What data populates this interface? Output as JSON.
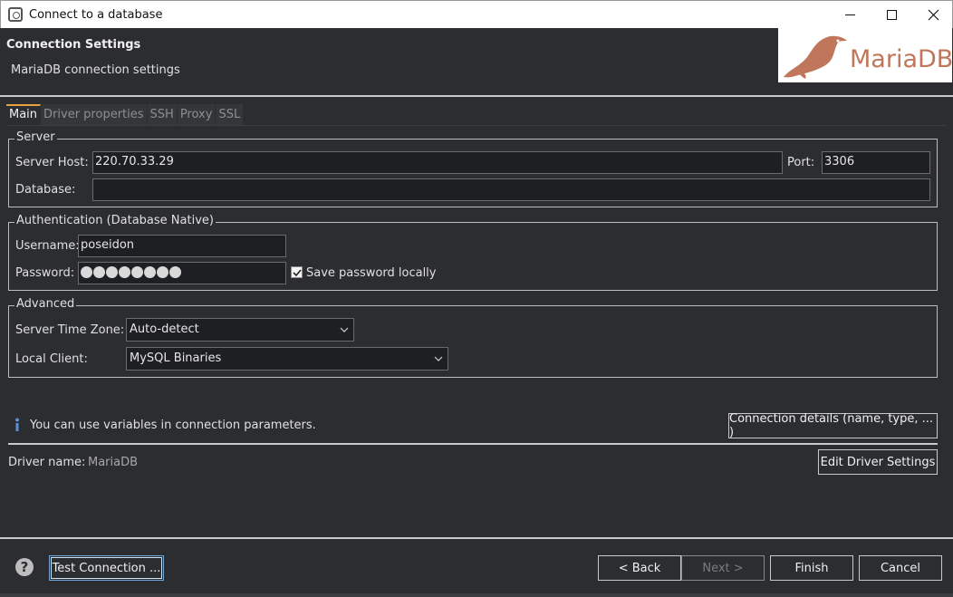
{
  "window": {
    "title": "Connect to a database"
  },
  "header": {
    "title": "Connection Settings",
    "subtitle": "MariaDB connection settings",
    "logo_text": "MariaDB"
  },
  "tabs": [
    {
      "label": "Main",
      "active": true
    },
    {
      "label": "Driver properties",
      "active": false
    },
    {
      "label": "SSH",
      "active": false
    },
    {
      "label": "Proxy",
      "active": false
    },
    {
      "label": "SSL",
      "active": false
    }
  ],
  "server": {
    "legend": "Server",
    "host_label": "Server Host:",
    "host_value": "220.70.33.29",
    "port_label": "Port:",
    "port_value": "3306",
    "database_label": "Database:",
    "database_value": ""
  },
  "auth": {
    "legend": "Authentication (Database Native)",
    "username_label": "Username:",
    "username_value": "poseidon",
    "password_label": "Password:",
    "password_length": 8,
    "save_password_label": "Save password locally",
    "save_password_checked": true
  },
  "advanced": {
    "legend": "Advanced",
    "timezone_label": "Server Time Zone:",
    "timezone_value": "Auto-detect",
    "client_label": "Local Client:",
    "client_value": "MySQL Binaries"
  },
  "info": {
    "text": "You can use variables in connection parameters.",
    "details_button": "Connection details (name, type, ... )"
  },
  "driver": {
    "label": "Driver name:",
    "value": "MariaDB",
    "edit_button": "Edit Driver Settings"
  },
  "footer": {
    "test_connection": "Test Connection ...",
    "back": "< Back",
    "next": "Next >",
    "finish": "Finish",
    "cancel": "Cancel"
  },
  "colors": {
    "background": "#2b2d30",
    "field_bg": "#1e1f22",
    "logo_text": "#c0765a",
    "active_tab_accent": "#e6a23c"
  }
}
